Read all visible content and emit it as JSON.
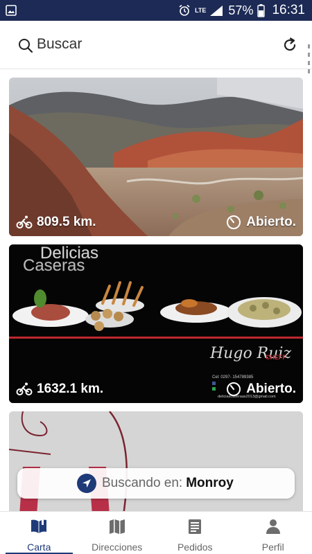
{
  "status_bar": {
    "battery": "57%",
    "time": "16:31",
    "network": "LTE"
  },
  "search": {
    "label": "Buscar"
  },
  "cards": [
    {
      "distance": "809.5 km.",
      "status": "Abierto."
    },
    {
      "distance": "1632.1 km.",
      "status": "Abierto.",
      "brand_line1": "Delicias",
      "brand_line2": "Caseras",
      "signature": "Hugo Ruiz",
      "signature_role": "CHEFF",
      "contact_phone": "Cel: 0297- 154789385",
      "contact_email": "deliciascaseraas2013@gmail.com"
    },
    {}
  ],
  "locating": {
    "prefix": "Buscando en:",
    "place": "Monroy"
  },
  "bottom_nav": [
    {
      "label": "Carta",
      "icon": "menu-book-icon",
      "active": true
    },
    {
      "label": "Direcciones",
      "icon": "map-icon",
      "active": false
    },
    {
      "label": "Pedidos",
      "icon": "orders-list-icon",
      "active": false
    },
    {
      "label": "Perfil",
      "icon": "person-icon",
      "active": false
    }
  ],
  "colors": {
    "status_bar": "#1c2a55",
    "accent": "#1e3a78",
    "cheff_red": "#c0282e"
  }
}
